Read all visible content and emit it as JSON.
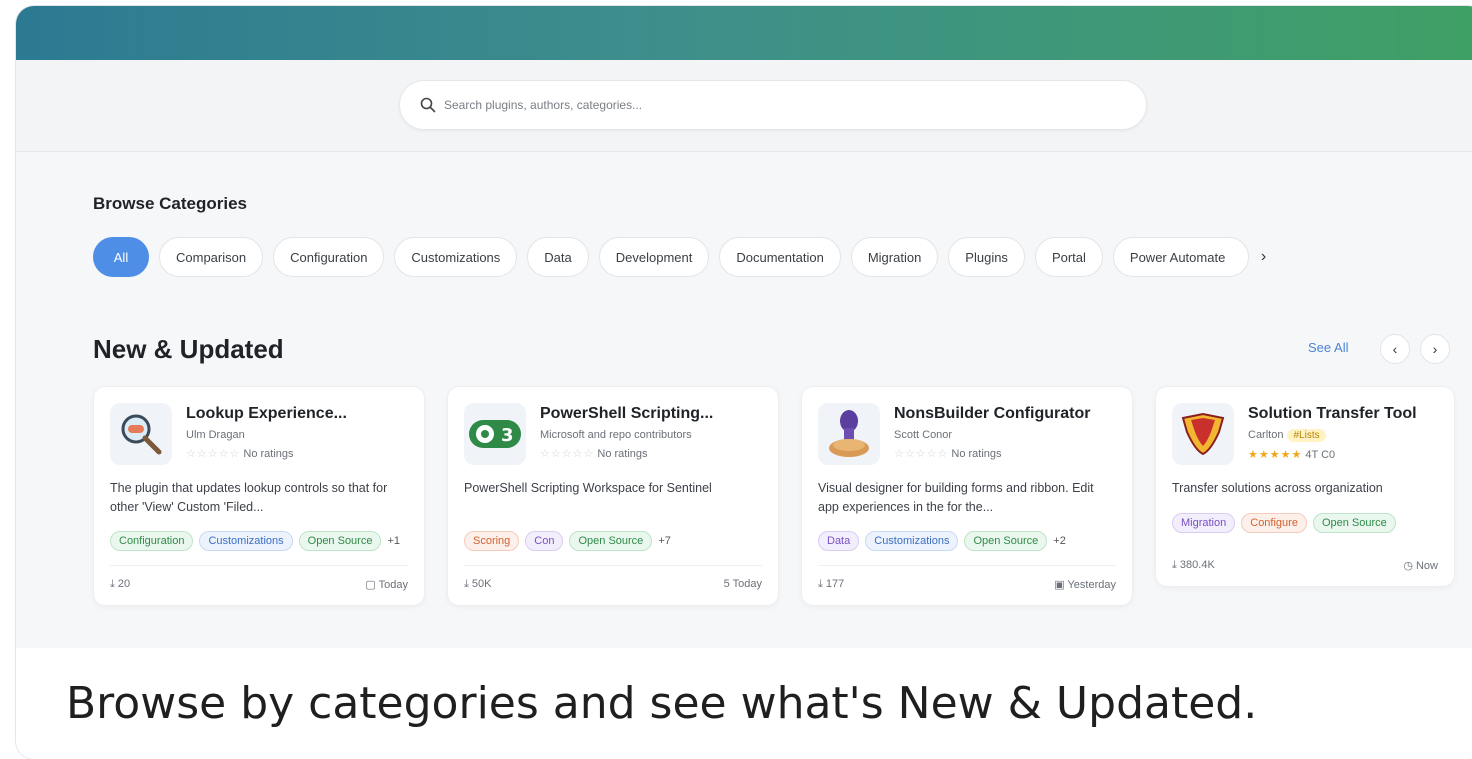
{
  "search": {
    "placeholder": "Search plugins, authors, categories..."
  },
  "categories": {
    "title": "Browse Categories",
    "items": [
      "All",
      "Comparison",
      "Configuration",
      "Customizations",
      "Data",
      "Development",
      "Documentation",
      "Migration",
      "Plugins",
      "Portal",
      "Power Automate"
    ]
  },
  "new_updated": {
    "title": "New & Updated",
    "see_all": "See All",
    "cards": [
      {
        "title": "Lookup Experience...",
        "author": "Ulm Dragan",
        "rating": "No ratings",
        "stars": "☆☆☆☆☆",
        "description": "The plugin that updates lookup controls so that for other 'View' Custom 'Filed...",
        "tags": [
          "Configuration",
          "Customizations",
          "Open Source"
        ],
        "more": "+1",
        "downloads": "20",
        "updated": "Today"
      },
      {
        "title": "PowerShell Scripting...",
        "author": "Microsoft and repo contributors",
        "rating": "No ratings",
        "stars": "☆☆☆☆☆",
        "description": "PowerShell Scripting Workspace for Sentinel",
        "tags": [
          "Scoring",
          "Con",
          "Open Source"
        ],
        "more": "+7",
        "downloads": "50K",
        "updated": "5 Today"
      },
      {
        "title": "NonsBuilder Configurator",
        "author": "Scott Conor",
        "rating": "No ratings",
        "stars": "☆☆☆☆☆",
        "description": "Visual designer for building forms and ribbon. Edit app experiences in the for the...",
        "tags": [
          "Data",
          "Customizations",
          "Open Source"
        ],
        "more": "+2",
        "downloads": "177",
        "updated": "Yesterday"
      },
      {
        "title": "Solution Transfer Tool",
        "author": "Carlton",
        "badge": "#Lists",
        "stars": "★★★★★",
        "rating": "4T C0",
        "description": "Transfer solutions across organization",
        "tags": [
          "Migration",
          "Configure",
          "Open Source"
        ],
        "more": "",
        "downloads": "380.4K",
        "updated": "Now"
      }
    ]
  },
  "caption": "Browse by categories and see what's New & Updated."
}
